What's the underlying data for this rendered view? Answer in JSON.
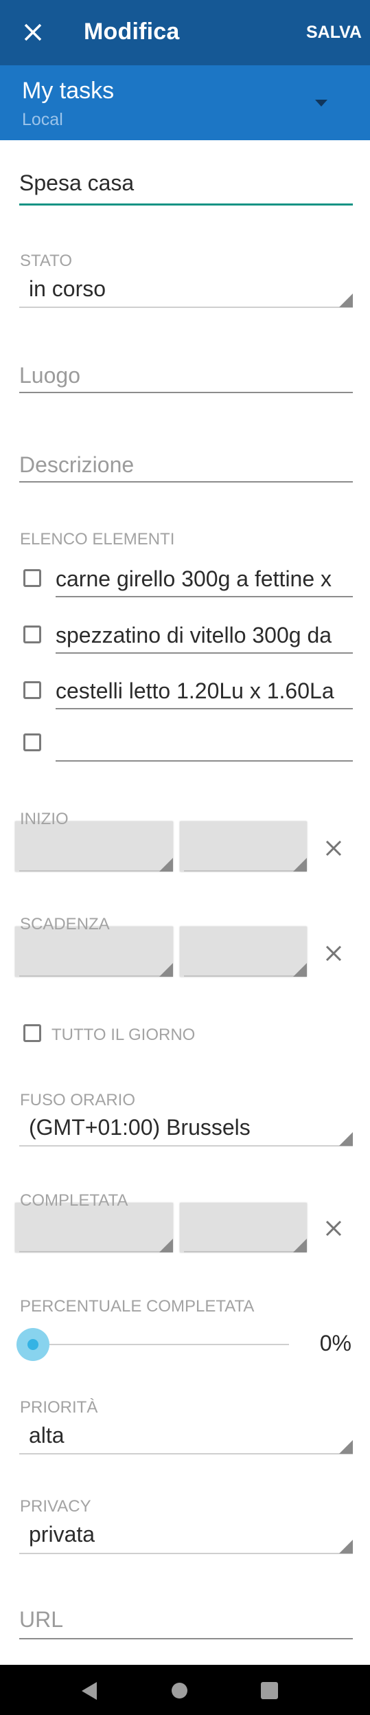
{
  "toolbar": {
    "title": "Modifica",
    "save_label": "SALVA",
    "close_icon": "close-icon"
  },
  "account": {
    "name": "My tasks",
    "type": "Local",
    "dropdown_icon": "dropdown-arrow-icon"
  },
  "title_field": {
    "value": "Spesa casa",
    "accent_color": "#139384"
  },
  "status": {
    "label": "STATO",
    "value": "in corso"
  },
  "location": {
    "placeholder": "Luogo",
    "value": ""
  },
  "description": {
    "placeholder": "Descrizione",
    "value": ""
  },
  "checklist": {
    "label": "ELENCO ELEMENTI",
    "items": [
      {
        "text": "carne girello 300g a fettine x",
        "checked": false
      },
      {
        "text": "spezzatino di vitello 300g da",
        "checked": false
      },
      {
        "text": "cestelli letto 1.20Lu x 1.60La",
        "checked": false
      },
      {
        "text": "",
        "checked": false
      }
    ]
  },
  "start": {
    "label": "INIZIO",
    "date": "",
    "time": ""
  },
  "due": {
    "label": "SCADENZA",
    "date": "",
    "time": ""
  },
  "all_day": {
    "label": "TUTTO IL GIORNO",
    "checked": false
  },
  "timezone": {
    "label": "FUSO ORARIO",
    "value": "(GMT+01:00) Brussels"
  },
  "completed": {
    "label": "COMPLETATA",
    "date": "",
    "time": ""
  },
  "percent": {
    "label": "PERCENTUALE COMPLETATA",
    "value": 0,
    "display": "0%",
    "accent_color": "#34b3e4"
  },
  "priority": {
    "label": "PRIORITÀ",
    "value": "alta"
  },
  "privacy": {
    "label": "PRIVACY",
    "value": "privata"
  },
  "url": {
    "placeholder": "URL",
    "value": ""
  },
  "navbar": {
    "back_icon": "back-icon",
    "home_icon": "home-icon",
    "recents_icon": "recents-icon"
  }
}
